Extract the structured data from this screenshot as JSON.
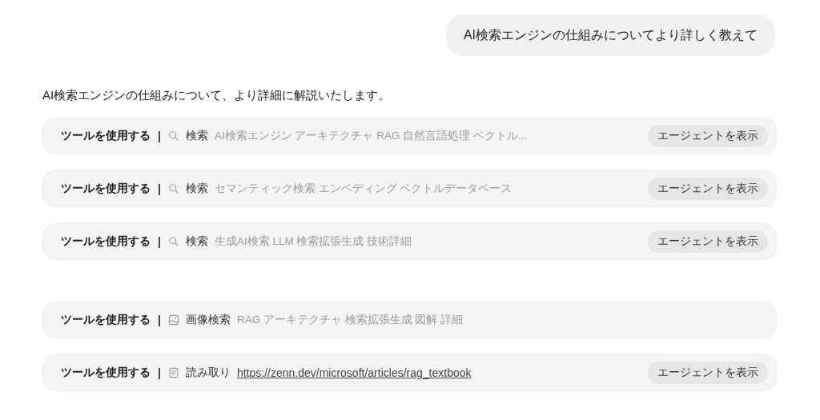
{
  "user_message": "AI検索エンジンの仕組みについてより詳しく教えて",
  "response_intro": "AI検索エンジンの仕組みについて、より詳細に解説いたします。",
  "tool_groups": [
    {
      "calls": [
        {
          "label": "ツールを使用する",
          "separator": "|",
          "kind": "search",
          "action": "検索",
          "detail": "AI検索エンジン アーキテクチャ RAG 自然言語処理 ベクトル...",
          "is_link": false,
          "button": "エージェントを表示"
        },
        {
          "label": "ツールを使用する",
          "separator": "|",
          "kind": "search",
          "action": "検索",
          "detail": "セマンティック検索 エンベディング ベクトルデータベース",
          "is_link": false,
          "button": "エージェントを表示"
        },
        {
          "label": "ツールを使用する",
          "separator": "|",
          "kind": "search",
          "action": "検索",
          "detail": "生成AI検索 LLM 検索拡張生成 技術詳細",
          "is_link": false,
          "button": "エージェントを表示"
        }
      ]
    },
    {
      "calls": [
        {
          "label": "ツールを使用する",
          "separator": "|",
          "kind": "image_search",
          "action": "画像検索",
          "detail": "RAG アーキテクチャ 検索拡張生成 図解 詳細",
          "is_link": false
        },
        {
          "label": "ツールを使用する",
          "separator": "|",
          "kind": "read",
          "action": "読み取り",
          "detail": "https://zenn.dev/microsoft/articles/rag_textbook",
          "is_link": true,
          "button": "エージェントを表示"
        }
      ]
    }
  ]
}
